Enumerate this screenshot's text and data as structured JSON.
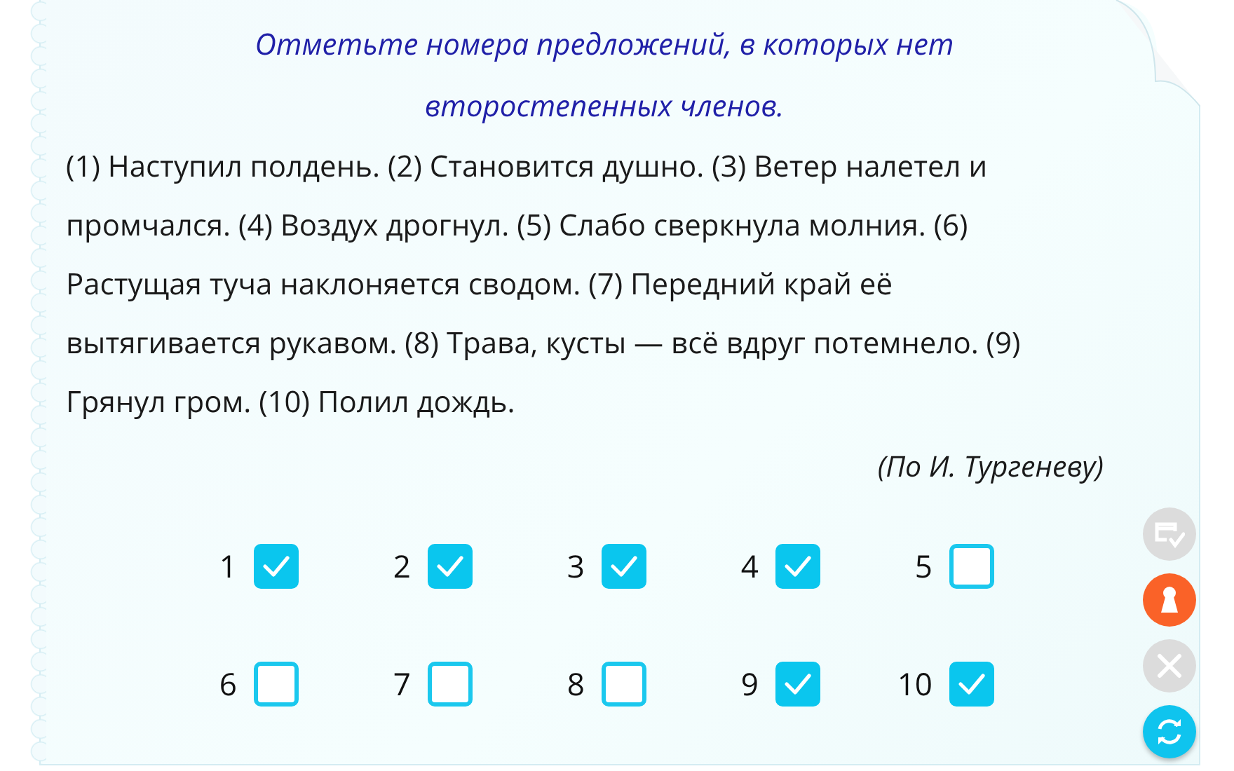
{
  "task": {
    "title": "Отметьте номера предложений, в которых нет второстепенных членов.",
    "text": "(1) Наступил полдень. (2) Становится душно. (3) Ветер налетел и промчался. (4) Воздух дрогнул. (5) Слабо сверкнула молния. (6) Растущая туча наклоняется сводом. (7) Передний край её вытягивается рукавом. (8) Трава, кусты — всё вдруг потемнело. (9) Грянул гром. (10) Полил дождь.",
    "source": "(По И. Тургеневу)"
  },
  "answers": [
    {
      "label": "1",
      "checked": true
    },
    {
      "label": "2",
      "checked": true
    },
    {
      "label": "3",
      "checked": true
    },
    {
      "label": "4",
      "checked": true
    },
    {
      "label": "5",
      "checked": false
    },
    {
      "label": "6",
      "checked": false
    },
    {
      "label": "7",
      "checked": false
    },
    {
      "label": "8",
      "checked": false
    },
    {
      "label": "9",
      "checked": true
    },
    {
      "label": "10",
      "checked": true
    }
  ],
  "tools": [
    {
      "kind": "check",
      "disabled": true
    },
    {
      "kind": "answer",
      "disabled": false
    },
    {
      "kind": "clear",
      "disabled": true
    },
    {
      "kind": "retry",
      "disabled": false
    }
  ]
}
